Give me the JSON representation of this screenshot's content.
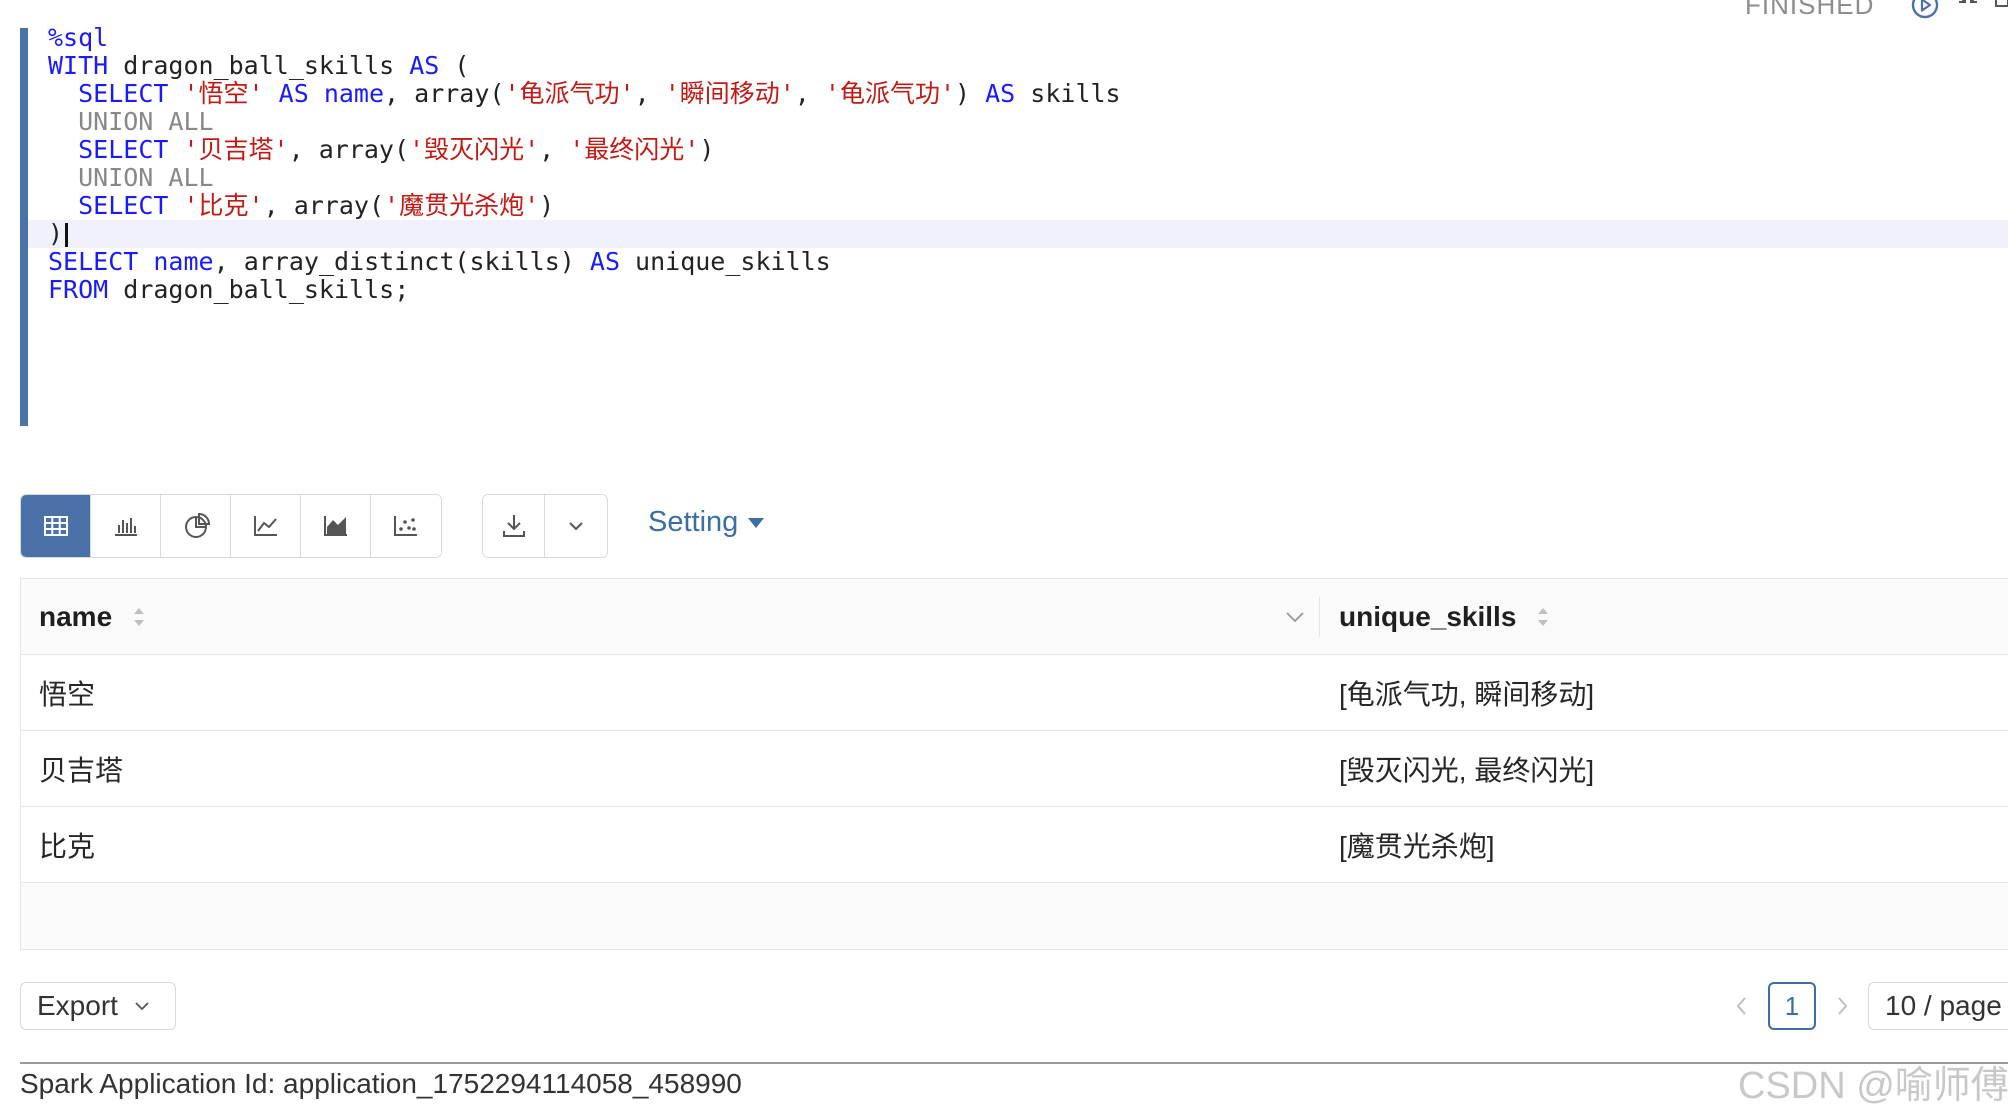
{
  "status": {
    "text": "FINISHED"
  },
  "editor": {
    "lines": [
      [
        {
          "t": "%sql",
          "c": "kw"
        }
      ],
      [
        {
          "t": "WITH",
          "c": "kw"
        },
        {
          "t": " dragon_ball_skills ",
          "c": ""
        },
        {
          "t": "AS",
          "c": "kw"
        },
        {
          "t": " (",
          "c": ""
        }
      ],
      [
        {
          "t": "  ",
          "c": ""
        },
        {
          "t": "SELECT",
          "c": "kw"
        },
        {
          "t": " ",
          "c": ""
        },
        {
          "t": "'悟空'",
          "c": "str"
        },
        {
          "t": " ",
          "c": ""
        },
        {
          "t": "AS",
          "c": "kw"
        },
        {
          "t": " ",
          "c": ""
        },
        {
          "t": "name",
          "c": "kw"
        },
        {
          "t": ", array(",
          "c": ""
        },
        {
          "t": "'龟派气功'",
          "c": "str"
        },
        {
          "t": ", ",
          "c": ""
        },
        {
          "t": "'瞬间移动'",
          "c": "str"
        },
        {
          "t": ", ",
          "c": ""
        },
        {
          "t": "'龟派气功'",
          "c": "str"
        },
        {
          "t": ") ",
          "c": ""
        },
        {
          "t": "AS",
          "c": "kw"
        },
        {
          "t": " skills",
          "c": ""
        }
      ],
      [
        {
          "t": "  UNION ALL",
          "c": "kw-dim"
        }
      ],
      [
        {
          "t": "  ",
          "c": ""
        },
        {
          "t": "SELECT",
          "c": "kw"
        },
        {
          "t": " ",
          "c": ""
        },
        {
          "t": "'贝吉塔'",
          "c": "str"
        },
        {
          "t": ", array(",
          "c": ""
        },
        {
          "t": "'毁灭闪光'",
          "c": "str"
        },
        {
          "t": ", ",
          "c": ""
        },
        {
          "t": "'最终闪光'",
          "c": "str"
        },
        {
          "t": ")",
          "c": ""
        }
      ],
      [
        {
          "t": "  UNION ALL",
          "c": "kw-dim"
        }
      ],
      [
        {
          "t": "  ",
          "c": ""
        },
        {
          "t": "SELECT",
          "c": "kw"
        },
        {
          "t": " ",
          "c": ""
        },
        {
          "t": "'比克'",
          "c": "str"
        },
        {
          "t": ", array(",
          "c": ""
        },
        {
          "t": "'魔贯光杀炮'",
          "c": "str"
        },
        {
          "t": ")",
          "c": ""
        }
      ],
      [
        {
          "t": ")",
          "c": ""
        }
      ],
      [
        {
          "t": "SELECT",
          "c": "kw"
        },
        {
          "t": " ",
          "c": ""
        },
        {
          "t": "name",
          "c": "kw"
        },
        {
          "t": ", array_distinct(skills) ",
          "c": ""
        },
        {
          "t": "AS",
          "c": "kw"
        },
        {
          "t": " unique_skills",
          "c": ""
        }
      ],
      [
        {
          "t": "FROM",
          "c": "kw"
        },
        {
          "t": " dragon_ball_skills;",
          "c": ""
        }
      ]
    ],
    "active_line": 7
  },
  "toolbar": {
    "viz_buttons": [
      "table-icon",
      "bar-chart-icon",
      "pie-chart-icon",
      "line-chart-icon",
      "area-chart-icon",
      "scatter-chart-icon"
    ],
    "active_viz": 0,
    "setting_label": "Setting"
  },
  "table": {
    "columns": [
      "name",
      "unique_skills"
    ],
    "rows": [
      [
        "悟空",
        "[龟派气功, 瞬间移动]"
      ],
      [
        "贝吉塔",
        "[毁灭闪光, 最终闪光]"
      ],
      [
        "比克",
        "[魔贯光杀炮]"
      ]
    ]
  },
  "footer": {
    "export_label": "Export",
    "current_page": "1",
    "page_size": "10 / page",
    "app_id": "Spark Application Id: application_1752294114058_458990",
    "watermark": "CSDN @喻师傅"
  },
  "colors": {
    "accent": "#4a72a8",
    "link": "#3a6ea5",
    "keyword": "#1a1aff",
    "string": "#c41a16"
  }
}
